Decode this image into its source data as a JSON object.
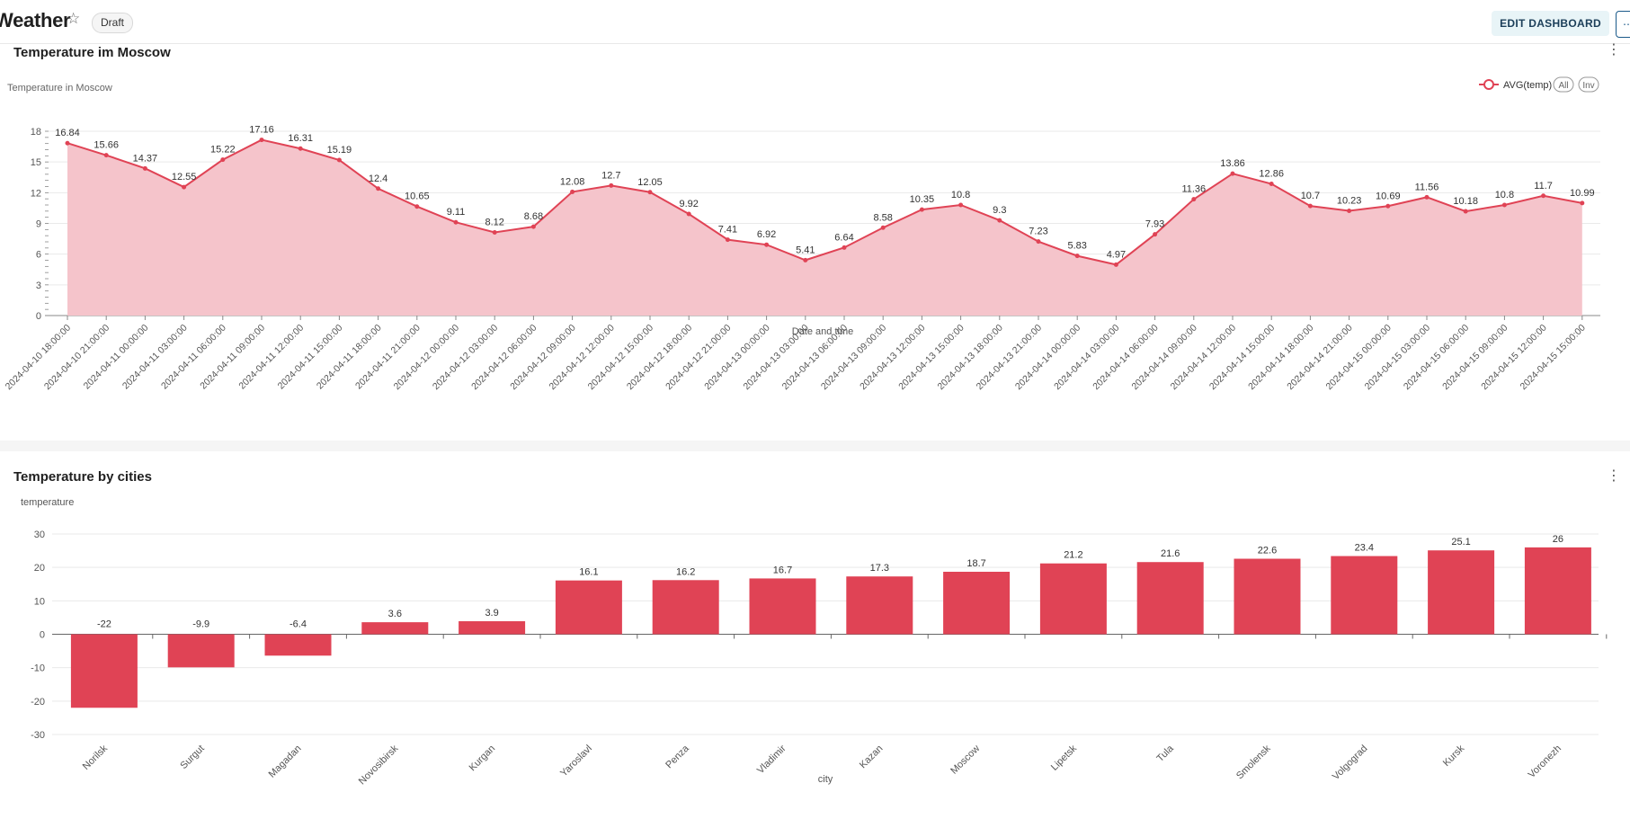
{
  "header": {
    "title": "Weather",
    "status_badge": "Draft",
    "edit_button": "EDIT DASHBOARD"
  },
  "colors": {
    "series": "#e04355",
    "area_fill": "#f5c4cb",
    "edit_button_bg": "#e8f4f7"
  },
  "icons": {
    "favorite": "star-icon",
    "more": "more-options-icon",
    "panel_menu": "vertical-dots-icon"
  },
  "panels": [
    {
      "title": "Temperature im Moscow"
    },
    {
      "title": "Temperature by cities"
    }
  ],
  "chart_data": [
    {
      "type": "area",
      "title": "Temperature im Moscow",
      "ylabel": "Temperature in Moscow",
      "xlabel": "Date and time",
      "ylim": [
        0,
        18
      ],
      "yticks": [
        0,
        3,
        6,
        9,
        12,
        15,
        18
      ],
      "grid": true,
      "legend": {
        "position": "top-right",
        "entries": [
          "AVG(temp)"
        ],
        "controls": [
          "All",
          "Inv"
        ]
      },
      "categories": [
        "2024-04-10 18:00:00",
        "2024-04-10 21:00:00",
        "2024-04-11 00:00:00",
        "2024-04-11 03:00:00",
        "2024-04-11 06:00:00",
        "2024-04-11 09:00:00",
        "2024-04-11 12:00:00",
        "2024-04-11 15:00:00",
        "2024-04-11 18:00:00",
        "2024-04-11 21:00:00",
        "2024-04-12 00:00:00",
        "2024-04-12 03:00:00",
        "2024-04-12 06:00:00",
        "2024-04-12 09:00:00",
        "2024-04-12 12:00:00",
        "2024-04-12 15:00:00",
        "2024-04-12 18:00:00",
        "2024-04-12 21:00:00",
        "2024-04-13 00:00:00",
        "2024-04-13 03:00:00",
        "2024-04-13 06:00:00",
        "2024-04-13 09:00:00",
        "2024-04-13 12:00:00",
        "2024-04-13 15:00:00",
        "2024-04-13 18:00:00",
        "2024-04-13 21:00:00",
        "2024-04-14 00:00:00",
        "2024-04-14 03:00:00",
        "2024-04-14 06:00:00",
        "2024-04-14 09:00:00",
        "2024-04-14 12:00:00",
        "2024-04-14 15:00:00",
        "2024-04-14 18:00:00",
        "2024-04-14 21:00:00",
        "2024-04-15 00:00:00",
        "2024-04-15 03:00:00",
        "2024-04-15 06:00:00",
        "2024-04-15 09:00:00",
        "2024-04-15 12:00:00",
        "2024-04-15 15:00:00"
      ],
      "series": [
        {
          "name": "AVG(temp)",
          "values": [
            16.84,
            15.66,
            14.37,
            12.55,
            15.22,
            17.16,
            16.31,
            15.19,
            12.4,
            10.65,
            9.11,
            8.12,
            8.68,
            12.08,
            12.7,
            12.05,
            9.92,
            7.41,
            6.92,
            5.41,
            6.64,
            8.58,
            10.35,
            10.8,
            9.3,
            7.23,
            5.83,
            4.97,
            7.93,
            11.36,
            13.86,
            12.86,
            10.7,
            10.23,
            10.69,
            11.56,
            10.18,
            10.8,
            11.7,
            10.99
          ]
        }
      ]
    },
    {
      "type": "bar",
      "title": "Temperature by cities",
      "ylabel": "temperature",
      "xlabel": "city",
      "ylim": [
        -30,
        30
      ],
      "yticks": [
        -30,
        -20,
        -10,
        0,
        10,
        20,
        30
      ],
      "grid": true,
      "categories": [
        "Norilsk",
        "Surgut",
        "Magadan",
        "Novosibirsk",
        "Kurgan",
        "Yaroslavl",
        "Penza",
        "Vladimir",
        "Kazan",
        "Moscow",
        "Lipetsk",
        "Tula",
        "Smolensk",
        "Volgograd",
        "Kursk",
        "Voronezh"
      ],
      "values": [
        -22,
        -9.9,
        -6.4,
        3.6,
        3.9,
        16.1,
        16.2,
        16.7,
        17.3,
        18.7,
        21.2,
        21.6,
        22.6,
        23.4,
        25.1,
        26
      ]
    }
  ]
}
